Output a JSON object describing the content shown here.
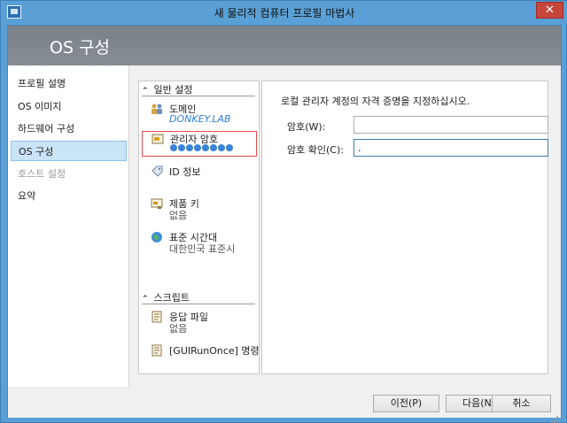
{
  "window": {
    "title": "새 물리적 컴퓨터 프로필 마법사",
    "close_glyph": "✕"
  },
  "header": {
    "heading": "OS 구성"
  },
  "nav": {
    "items": [
      {
        "label": "프로필 설명",
        "state": "normal"
      },
      {
        "label": "OS 이미지",
        "state": "normal"
      },
      {
        "label": "하드웨어 구성",
        "state": "normal"
      },
      {
        "label": "OS 구성",
        "state": "active"
      },
      {
        "label": "호스트 설정",
        "state": "disabled"
      },
      {
        "label": "요약",
        "state": "normal"
      }
    ]
  },
  "settings": {
    "general_header": "일반 설정",
    "script_header": "스크립트",
    "domain": {
      "label": "도메인",
      "value": "DONKEY.LAB",
      "icon": "domain-icon"
    },
    "admin_password": {
      "label": "관리자 암호",
      "icon": "password-icon"
    },
    "identity": {
      "label": "ID 정보",
      "icon": "tag-icon"
    },
    "product_key": {
      "label": "제품 키",
      "value": "없음",
      "icon": "key-icon"
    },
    "timezone": {
      "label": "표준 시간대",
      "value": "대한민국 표준시",
      "icon": "globe-icon"
    },
    "answer_file": {
      "label": "응답 파일",
      "value": "없음",
      "icon": "file-icon"
    },
    "gui_run_once": {
      "label": "[GUIRunOnce] 명령",
      "icon": "file-icon"
    }
  },
  "detail": {
    "instruction": "로컬 관리자 계정의 자격 증명을 지정하십시오.",
    "password_label": "암호(W):",
    "password_value": "",
    "confirm_label": "암호 확인(C):",
    "confirm_value": "."
  },
  "footer": {
    "prev": "이전(P)",
    "next": "다음(N)",
    "cancel": "취소"
  },
  "colors": {
    "accent": "#3a82d8",
    "selection_border": "#e34b4b",
    "nav_active_bg": "#c9e3f7",
    "header_band": "#80878e"
  }
}
